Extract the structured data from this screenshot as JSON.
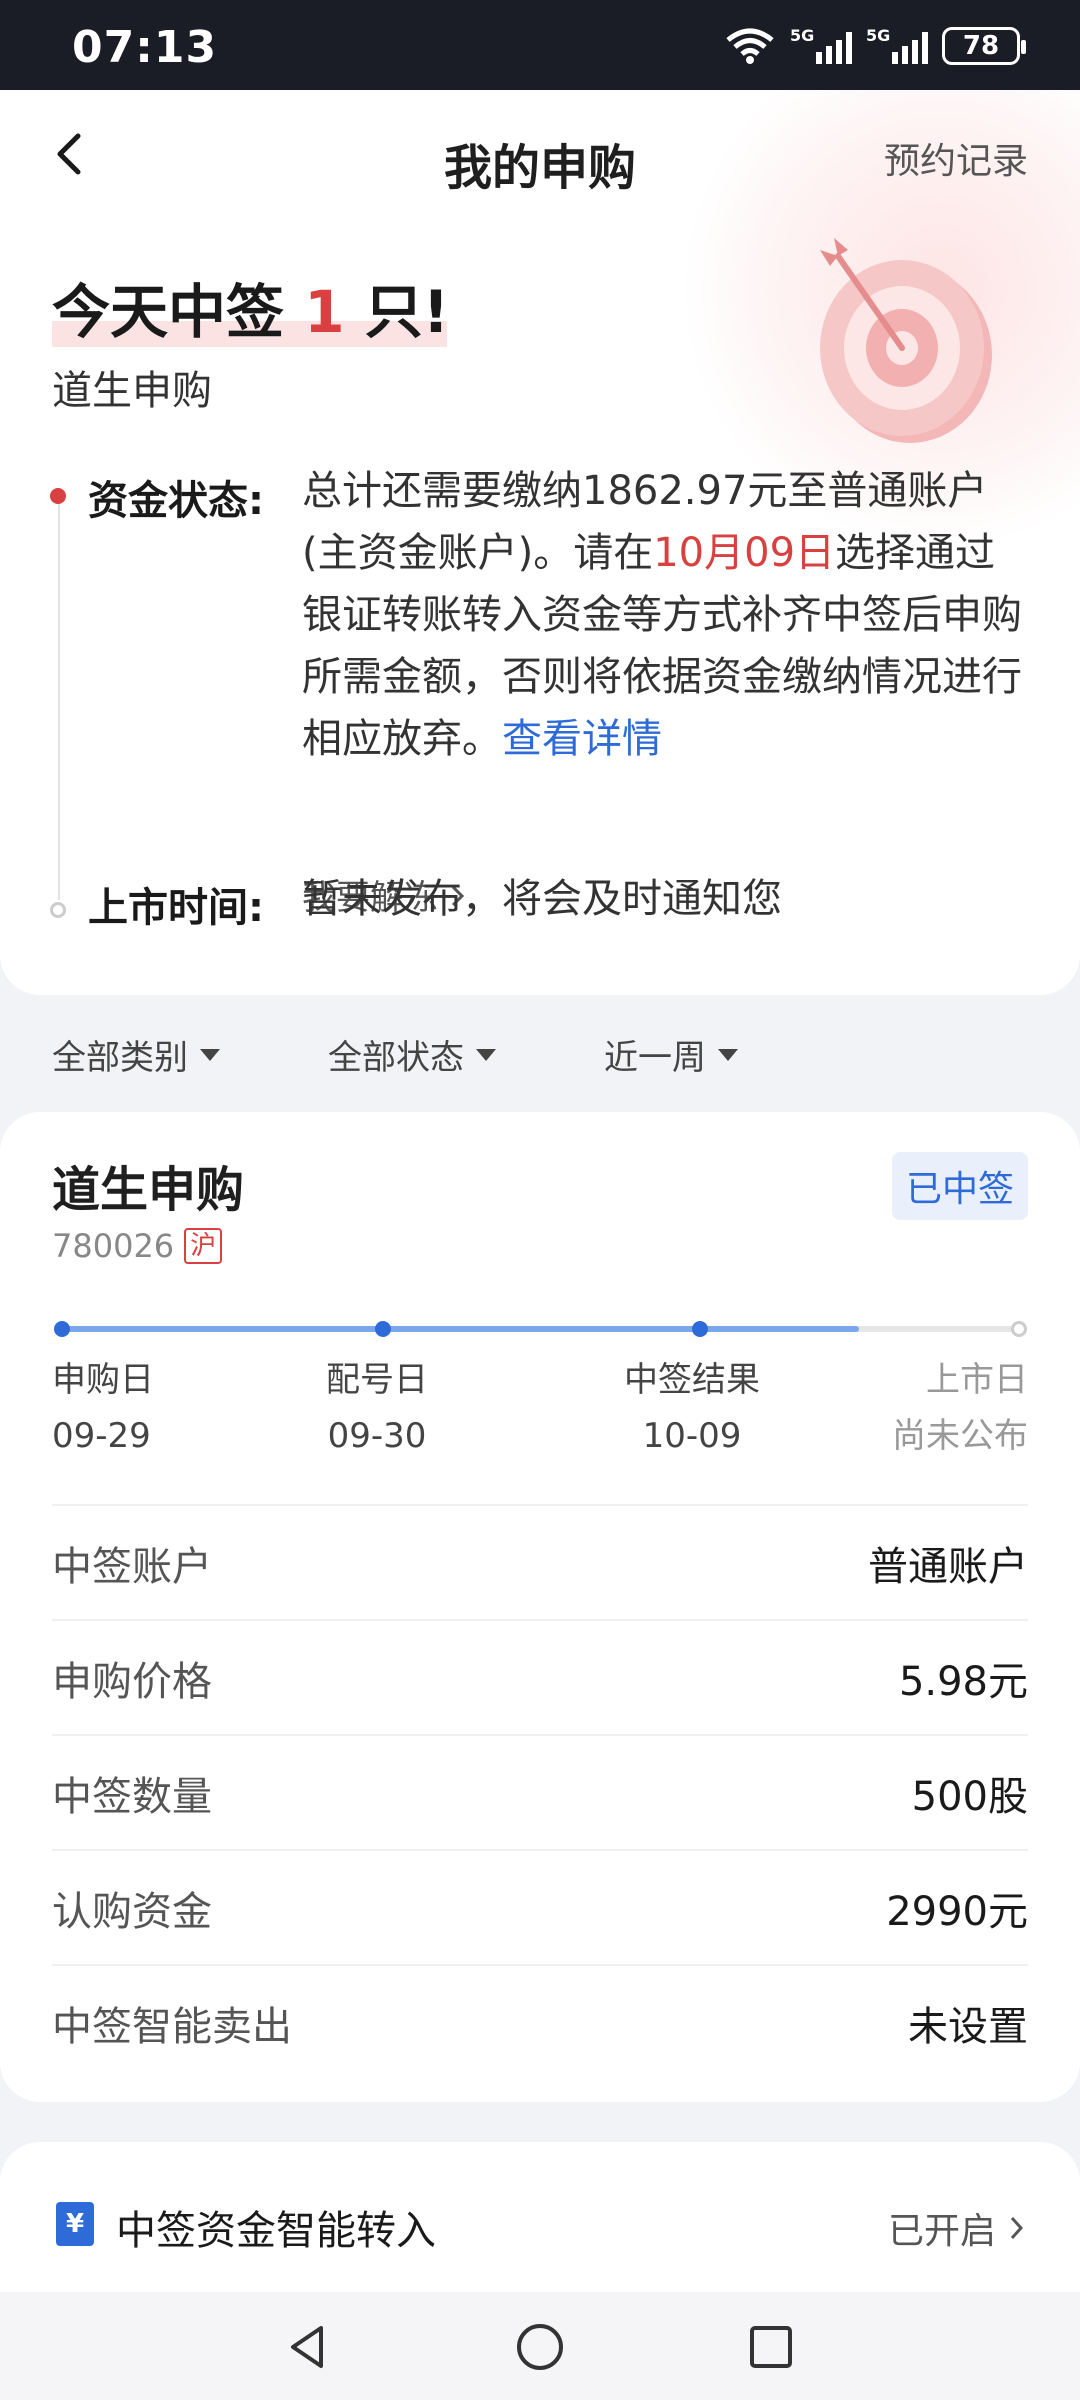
{
  "status_bar": {
    "time": "07:13",
    "battery": "78",
    "signal1": "5G",
    "signal2": "5G"
  },
  "nav": {
    "title": "我的申购",
    "right_link": "预约记录"
  },
  "summary": {
    "headline_prefix": "今天中签",
    "headline_count": "1",
    "headline_suffix": "只!",
    "stock": "道生申购",
    "fund_label": "资金状态:",
    "fund_text_1": "总计还需要缴纳1862.97元至普通账户(主资金账户)。请在",
    "fund_date": "10月09日",
    "fund_text_2": "选择通过银证转账转入资金等方式补齐中签后申购所需金额，否则将依据资金缴纳情况进行相应放弃。",
    "fund_link": "查看详情",
    "unfreeze": "我要解冻",
    "listing_label": "上市时间:",
    "listing_text": "暂未发布，将会及时通知您"
  },
  "filters": [
    "全部类别",
    "全部状态",
    "近一周"
  ],
  "detail": {
    "name": "道生申购",
    "code": "780026",
    "market": "沪",
    "status": "已中签",
    "progress": 0.83,
    "steps": [
      {
        "label": "申购日",
        "date": "09-29"
      },
      {
        "label": "配号日",
        "date": "09-30"
      },
      {
        "label": "中签结果",
        "date": "10-09"
      },
      {
        "label": "上市日",
        "date": "尚未公布"
      }
    ],
    "rows": [
      {
        "key": "中签账户",
        "value": "普通账户"
      },
      {
        "key": "申购价格",
        "value": "5.98元"
      },
      {
        "key": "中签数量",
        "value": "500股"
      },
      {
        "key": "认购资金",
        "value": "2990元"
      },
      {
        "key": "中签智能卖出",
        "value": "未设置"
      }
    ]
  },
  "bottom": {
    "label": "中签资金智能转入",
    "status": "已开启"
  },
  "colors": {
    "accent_red": "#d94040",
    "accent_blue": "#2f6bd8"
  }
}
